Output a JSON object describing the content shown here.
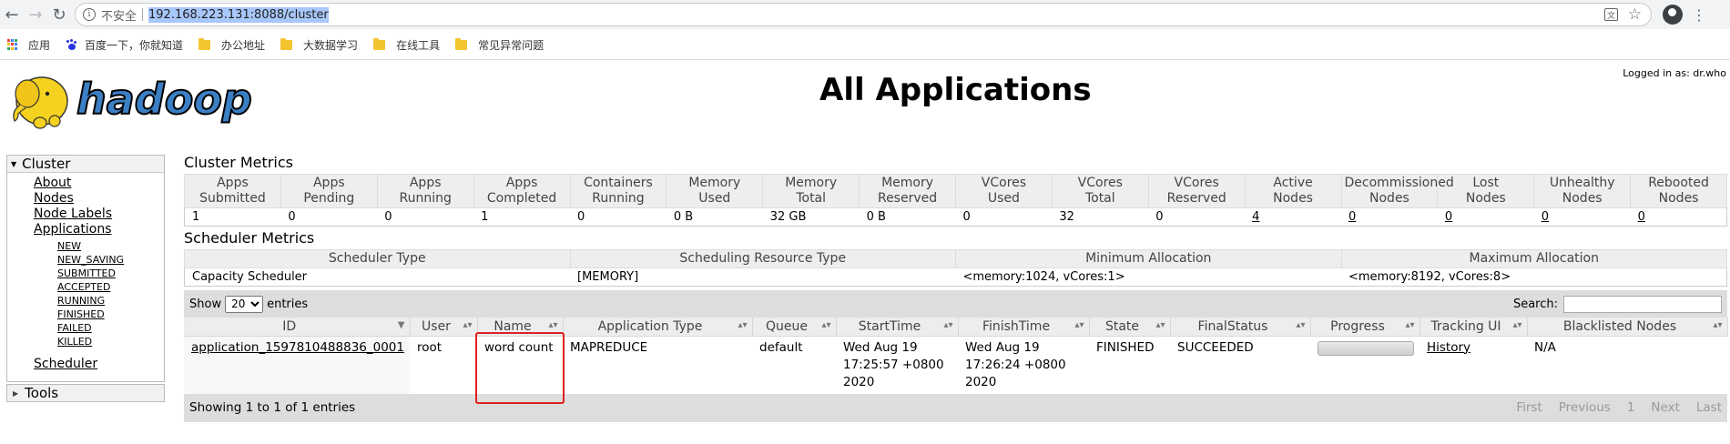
{
  "browser": {
    "security_label": "不安全",
    "url": "192.168.223.131:8088/cluster",
    "bookmarks": [
      {
        "label": "应用",
        "icon": "apps-grid-icon"
      },
      {
        "label": "百度一下，你就知道",
        "icon": "baidu-paw-icon"
      },
      {
        "label": "办公地址",
        "icon": "folder-icon"
      },
      {
        "label": "大数据学习",
        "icon": "folder-icon"
      },
      {
        "label": "在线工具",
        "icon": "folder-icon"
      },
      {
        "label": "常见异常问题",
        "icon": "folder-icon"
      }
    ]
  },
  "header": {
    "logged_in": "Logged in as: dr.who",
    "title": "All Applications",
    "logo_text": "hadoop"
  },
  "sidebar": {
    "cluster_label": "Cluster",
    "links": [
      "About",
      "Nodes",
      "Node Labels",
      "Applications"
    ],
    "states": [
      "NEW",
      "NEW_SAVING",
      "SUBMITTED",
      "ACCEPTED",
      "RUNNING",
      "FINISHED",
      "FAILED",
      "KILLED"
    ],
    "scheduler": "Scheduler",
    "tools": "Tools"
  },
  "cluster_metrics": {
    "title": "Cluster Metrics",
    "headers": [
      [
        "Apps",
        "Submitted"
      ],
      [
        "Apps",
        "Pending"
      ],
      [
        "Apps",
        "Running"
      ],
      [
        "Apps",
        "Completed"
      ],
      [
        "Containers",
        "Running"
      ],
      [
        "Memory",
        "Used"
      ],
      [
        "Memory",
        "Total"
      ],
      [
        "Memory",
        "Reserved"
      ],
      [
        "VCores",
        "Used"
      ],
      [
        "VCores",
        "Total"
      ],
      [
        "VCores",
        "Reserved"
      ],
      [
        "Active",
        "Nodes"
      ],
      [
        "Decommissioned",
        "Nodes"
      ],
      [
        "Lost",
        "Nodes"
      ],
      [
        "Unhealthy",
        "Nodes"
      ],
      [
        "Rebooted",
        "Nodes"
      ]
    ],
    "values": [
      "1",
      "0",
      "0",
      "1",
      "0",
      "0 B",
      "32 GB",
      "0 B",
      "0",
      "32",
      "0",
      "4",
      "0",
      "0",
      "0",
      "0"
    ]
  },
  "scheduler_metrics": {
    "title": "Scheduler Metrics",
    "headers": [
      "Scheduler Type",
      "Scheduling Resource Type",
      "Minimum Allocation",
      "Maximum Allocation"
    ],
    "values": [
      "Capacity Scheduler",
      "[MEMORY]",
      "<memory:1024, vCores:1>",
      "<memory:8192, vCores:8>"
    ]
  },
  "apps_table": {
    "show_label": "Show",
    "entries_label": "entries",
    "page_size": "20",
    "search_label": "Search:",
    "headers": [
      "ID",
      "User",
      "Name",
      "Application Type",
      "Queue",
      "StartTime",
      "FinishTime",
      "State",
      "FinalStatus",
      "Progress",
      "Tracking UI",
      "Blacklisted Nodes"
    ],
    "row": {
      "id": "application_1597810488836_0001",
      "user": "root",
      "name": "word count",
      "type": "MAPREDUCE",
      "queue": "default",
      "start": "Wed Aug 19 17:25:57 +0800 2020",
      "finish": "Wed Aug 19 17:26:24 +0800 2020",
      "state": "FINISHED",
      "final_status": "SUCCEEDED",
      "progress": 1.0,
      "tracking": "History",
      "blacklisted": "N/A"
    },
    "footer": "Showing 1 to 1 of 1 entries",
    "pager": [
      "First",
      "Previous",
      "1",
      "Next",
      "Last"
    ]
  }
}
